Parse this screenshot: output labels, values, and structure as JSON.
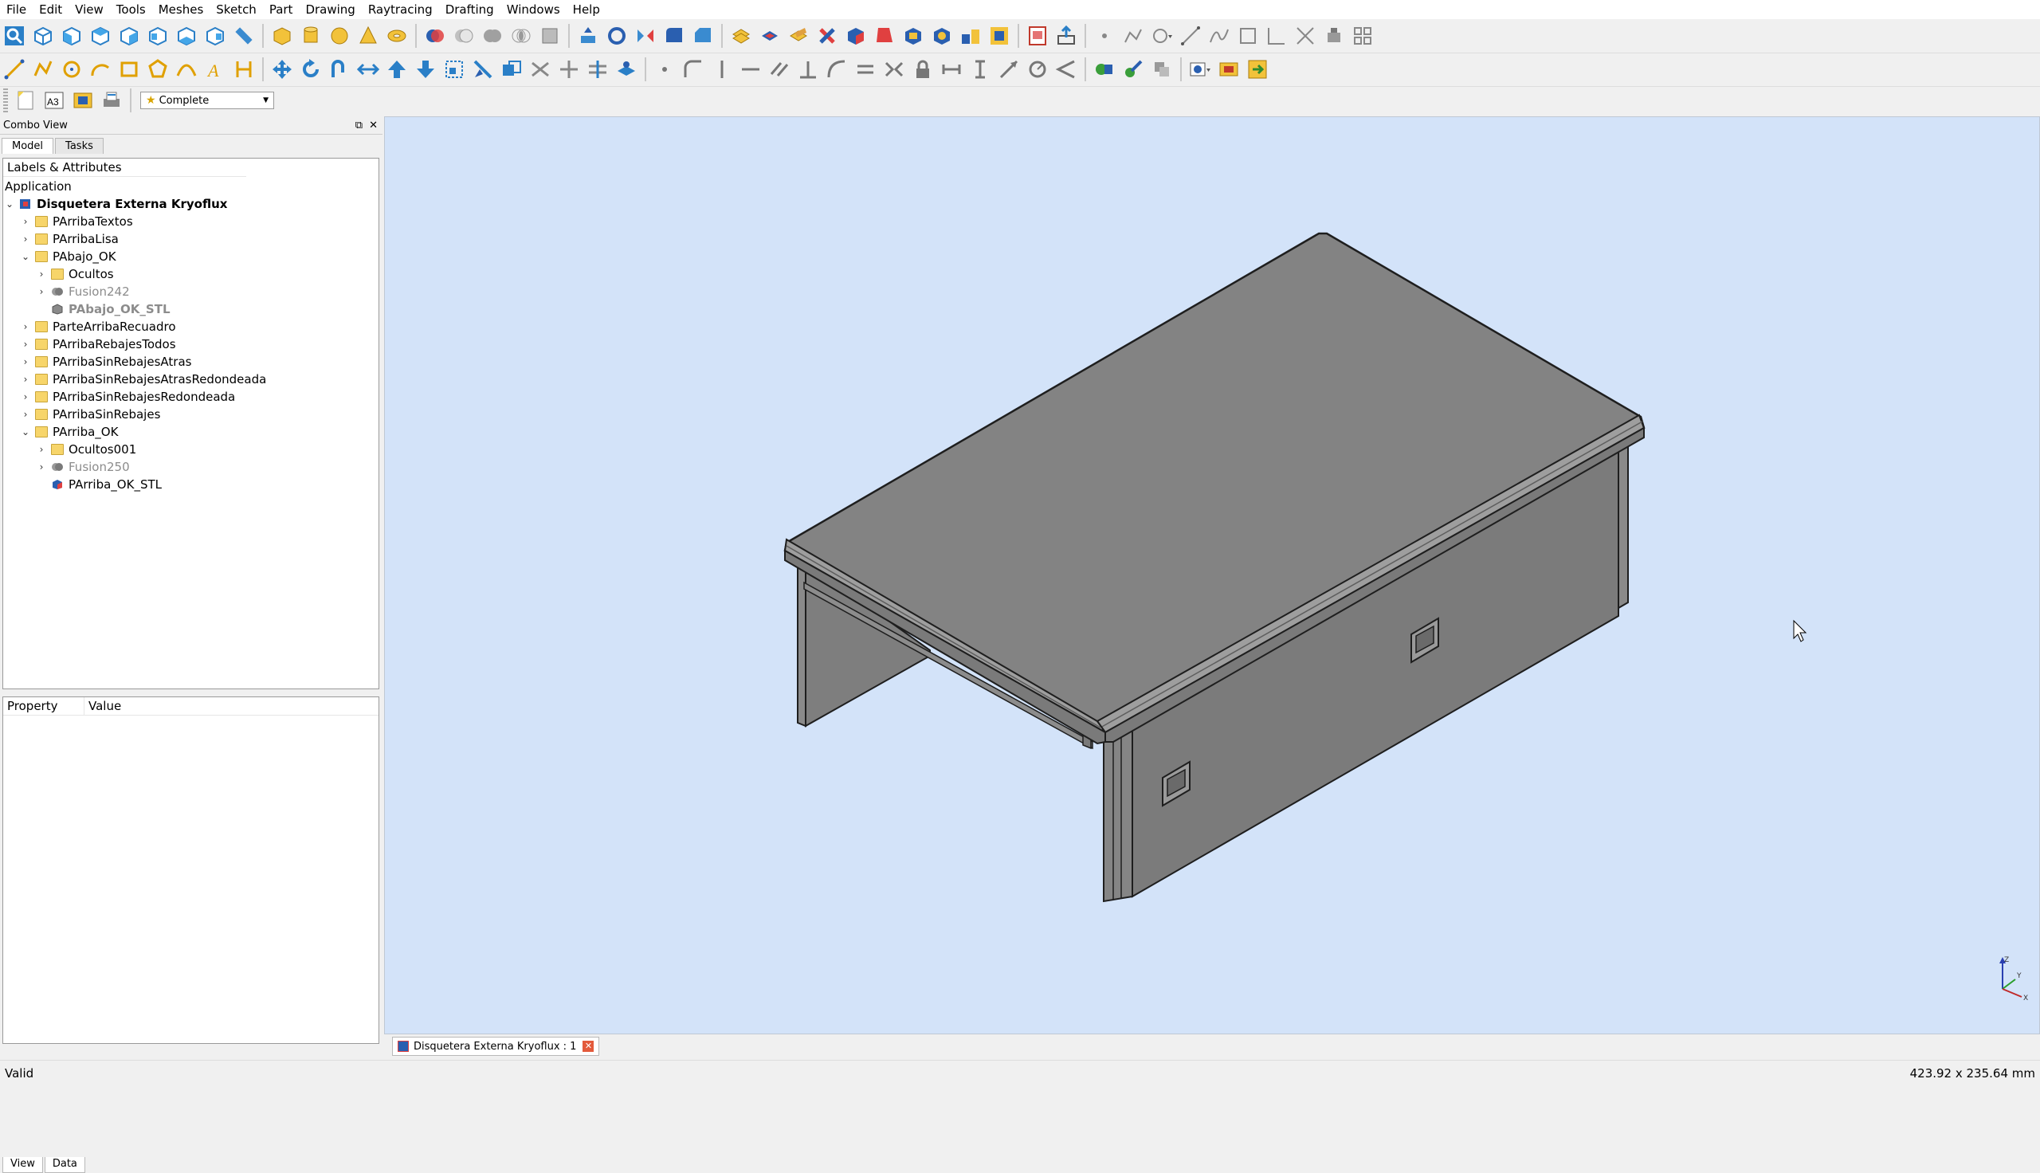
{
  "menu": [
    "File",
    "Edit",
    "View",
    "Tools",
    "Meshes",
    "Sketch",
    "Part",
    "Drawing",
    "Raytracing",
    "Drafting",
    "Windows",
    "Help"
  ],
  "workbench": {
    "selected": "Complete"
  },
  "combo_view": {
    "title": "Combo View",
    "tabs": [
      "Model",
      "Tasks"
    ]
  },
  "tree": {
    "header": "Labels & Attributes",
    "root_label": "Application",
    "document": "Disquetera Externa Kryoflux",
    "items": [
      {
        "label": "PArribaTextos",
        "level": 1,
        "expander": "closed",
        "icon": "folder",
        "greyed": false
      },
      {
        "label": "PArribaLisa",
        "level": 1,
        "expander": "closed",
        "icon": "folder",
        "greyed": false
      },
      {
        "label": "PAbajo_OK",
        "level": 1,
        "expander": "open",
        "icon": "folder",
        "greyed": false
      },
      {
        "label": "Ocultos",
        "level": 2,
        "expander": "closed",
        "icon": "folder",
        "greyed": false
      },
      {
        "label": "Fusion242",
        "level": 2,
        "expander": "closed",
        "icon": "fusion",
        "greyed": true
      },
      {
        "label": "PAbajo_OK_STL",
        "level": 2,
        "expander": "none",
        "icon": "mesh-grey",
        "greyed": true
      },
      {
        "label": "ParteArribaRecuadro",
        "level": 1,
        "expander": "closed",
        "icon": "folder",
        "greyed": false
      },
      {
        "label": "PArribaRebajesTodos",
        "level": 1,
        "expander": "closed",
        "icon": "folder",
        "greyed": false
      },
      {
        "label": "PArribaSinRebajesAtras",
        "level": 1,
        "expander": "closed",
        "icon": "folder",
        "greyed": false
      },
      {
        "label": "PArribaSinRebajesAtrasRedondeada",
        "level": 1,
        "expander": "closed",
        "icon": "folder",
        "greyed": false
      },
      {
        "label": "PArribaSinRebajesRedondeada",
        "level": 1,
        "expander": "closed",
        "icon": "folder",
        "greyed": false
      },
      {
        "label": "PArribaSinRebajes",
        "level": 1,
        "expander": "closed",
        "icon": "folder",
        "greyed": false
      },
      {
        "label": "PArriba_OK",
        "level": 1,
        "expander": "open",
        "icon": "folder",
        "greyed": false
      },
      {
        "label": "Ocultos001",
        "level": 2,
        "expander": "closed",
        "icon": "folder",
        "greyed": false
      },
      {
        "label": "Fusion250",
        "level": 2,
        "expander": "closed",
        "icon": "fusion",
        "greyed": true
      },
      {
        "label": "PArriba_OK_STL",
        "level": 2,
        "expander": "none",
        "icon": "mesh-color",
        "greyed": false
      }
    ]
  },
  "properties": {
    "col_property": "Property",
    "col_value": "Value"
  },
  "bottom_tabs": [
    "View",
    "Data"
  ],
  "document_tab": {
    "label": "Disquetera Externa Kryoflux : 1"
  },
  "status": {
    "text": "Valid",
    "dimensions": "423.92 x 235.64 mm"
  },
  "axis_labels": {
    "x": "X",
    "y": "Y",
    "z": "Z"
  },
  "colors": {
    "viewport_bg": "#d3e3f9",
    "model_top": "#838383",
    "model_side": "#7b7b7b",
    "model_edge": "#1e1e1e"
  }
}
